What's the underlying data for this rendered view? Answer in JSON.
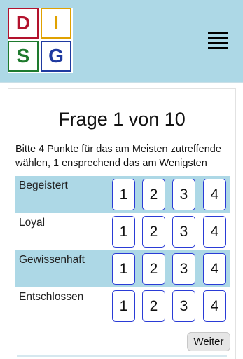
{
  "logo": {
    "letters": [
      "D",
      "I",
      "S",
      "G"
    ],
    "colors": [
      "#b3122d",
      "#e0a100",
      "#1e7a2e",
      "#1f3aa0"
    ]
  },
  "header": {
    "menu_icon": "hamburger-menu-icon",
    "background": "#add8e6"
  },
  "question": {
    "title": "Frage 1 von 10",
    "instruction": "Bitte 4 Punkte für das am Meisten zutreffende wählen, 1 ensprechend das am Wenigsten"
  },
  "rows": [
    {
      "label": "Begeistert",
      "options": [
        "1",
        "2",
        "3",
        "4"
      ]
    },
    {
      "label": "Loyal",
      "options": [
        "1",
        "2",
        "3",
        "4"
      ]
    },
    {
      "label": "Gewissenhaft",
      "options": [
        "1",
        "2",
        "3",
        "4"
      ]
    },
    {
      "label": "Entschlossen",
      "options": [
        "1",
        "2",
        "3",
        "4"
      ]
    }
  ],
  "next_label": "Weiter"
}
